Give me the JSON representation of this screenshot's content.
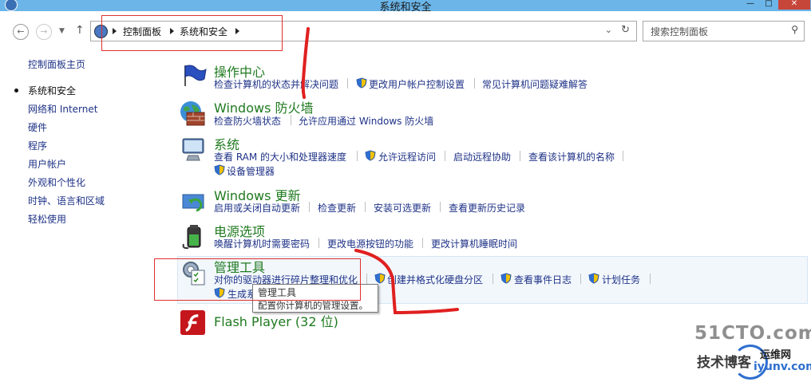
{
  "window": {
    "title": "系统和安全",
    "buttons": {
      "minimize": "—",
      "maximize": "□",
      "close": "✕"
    }
  },
  "nav": {
    "back_icon": "arrow-left",
    "forward_icon": "arrow-right",
    "dropdown_icon": "chevron-down",
    "up_icon": "arrow-up",
    "breadcrumb": [
      "控制面板",
      "系统和安全"
    ],
    "search_placeholder": "搜索控制面板"
  },
  "sidebar": {
    "items": [
      {
        "label": "控制面板主页"
      },
      {
        "label": "系统和安全",
        "current": true
      },
      {
        "label": "网络和 Internet"
      },
      {
        "label": "硬件"
      },
      {
        "label": "程序"
      },
      {
        "label": "用户帐户"
      },
      {
        "label": "外观和个性化"
      },
      {
        "label": "时钟、语言和区域"
      },
      {
        "label": "轻松使用"
      }
    ]
  },
  "categories": {
    "action_center": {
      "title": "操作中心",
      "links": [
        "检查计算机的状态并解决问题",
        "更改用户帐户控制设置",
        "常见计算机问题疑难解答"
      ]
    },
    "firewall": {
      "title": "Windows 防火墙",
      "links": [
        "检查防火墙状态",
        "允许应用通过 Windows 防火墙"
      ]
    },
    "system": {
      "title": "系统",
      "links": [
        "查看 RAM 的大小和处理器速度",
        "允许远程访问",
        "启动远程协助",
        "查看该计算机的名称",
        "设备管理器"
      ]
    },
    "update": {
      "title": "Windows 更新",
      "links": [
        "启用或关闭自动更新",
        "检查更新",
        "安装可选更新",
        "查看更新历史记录"
      ]
    },
    "power": {
      "title": "电源选项",
      "links": [
        "唤醒计算机时需要密码",
        "更改电源按钮的功能",
        "更改计算机睡眠时间"
      ]
    },
    "admin_tools": {
      "title": "管理工具",
      "links": [
        "对你的驱动器进行碎片整理和优化",
        "创建并格式化硬盘分区",
        "查看事件日志",
        "计划任务",
        "生成系"
      ]
    },
    "flash": {
      "title": "Flash Player (32 位)"
    }
  },
  "tooltip": {
    "title": "管理工具",
    "description": "配置你计算机的管理设置。"
  },
  "watermark": {
    "line1": "51CTO.com",
    "line2": "技术博客",
    "line3": "运维网",
    "line4": "iyunv.com"
  },
  "colors": {
    "titlebar": "#6bb5e8",
    "link": "#1e3287",
    "category_title": "#1f7a1f",
    "annotation": "#e03030"
  }
}
